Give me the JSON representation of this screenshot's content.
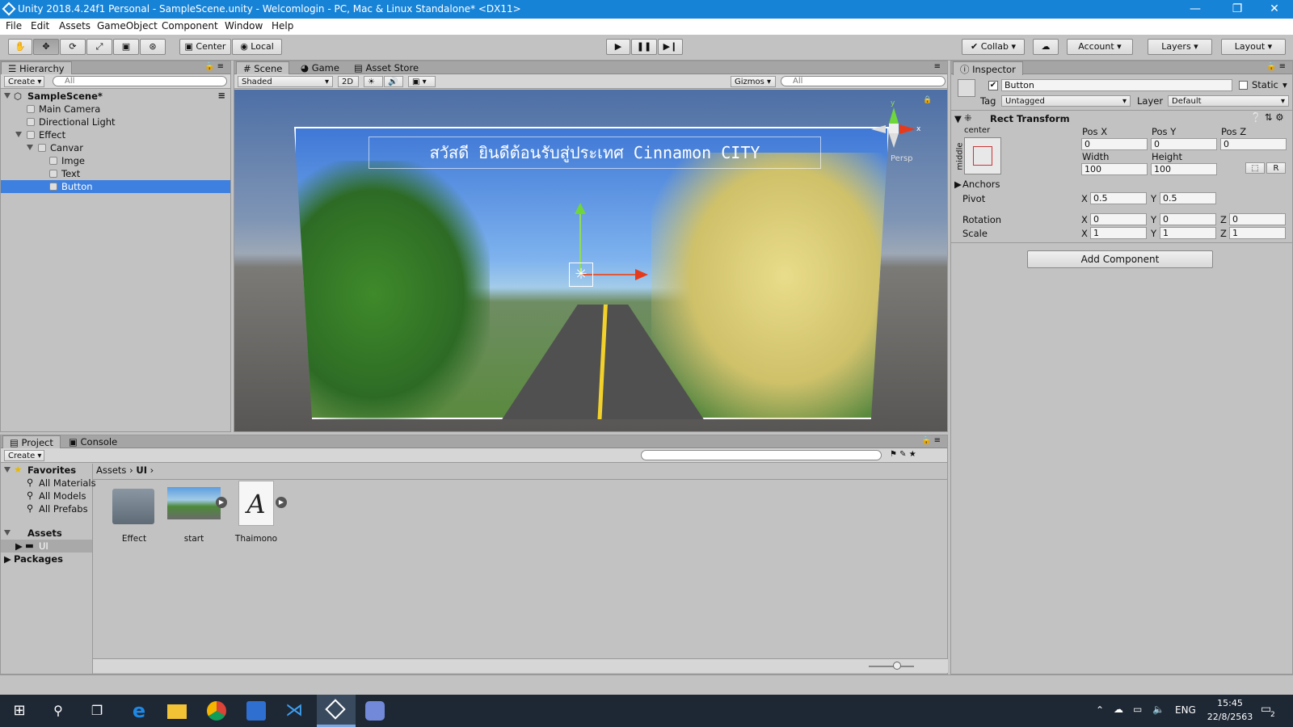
{
  "window": {
    "title": "Unity 2018.4.24f1 Personal - SampleScene.unity - Welcomlogin - PC, Mac & Linux Standalone* <DX11>",
    "controls": {
      "minimize": "—",
      "maximize": "❐",
      "close": "✕"
    }
  },
  "menu": [
    "File",
    "Edit",
    "Assets",
    "GameObject",
    "Component",
    "Window",
    "Help"
  ],
  "toolbar": {
    "pivot": "Center",
    "space": "Local",
    "collab": "Collab",
    "account": "Account",
    "layers": "Layers",
    "layout": "Layout"
  },
  "hierarchy": {
    "tab": "Hierarchy",
    "create": "Create",
    "search_placeholder": "All",
    "scene": "SampleScene*",
    "items": [
      "Main Camera",
      "Directional Light",
      "Effect",
      "Canvar",
      "Imge",
      "Text",
      "Button"
    ]
  },
  "scene_view": {
    "tabs": [
      "Scene",
      "Game",
      "Asset Store"
    ],
    "shading": "Shaded",
    "mode_2d": "2D",
    "gizmos": "Gizmos",
    "search_placeholder": "All",
    "banner_text": "สวัสดี ยินดีต้อนรับสู่ประเทศ Cinnamon CITY",
    "persp_label": "Persp",
    "axis_y": "y",
    "axis_x": "x"
  },
  "inspector": {
    "tab": "Inspector",
    "object_name": "Button",
    "static_label": "Static",
    "tag_label": "Tag",
    "tag_value": "Untagged",
    "layer_label": "Layer",
    "layer_value": "Default",
    "component": "Rect Transform",
    "anchor_h": "center",
    "anchor_v": "middle",
    "pos_x_label": "Pos X",
    "pos_x": "0",
    "pos_y_label": "Pos Y",
    "pos_y": "0",
    "pos_z_label": "Pos Z",
    "pos_z": "0",
    "width_label": "Width",
    "width": "100",
    "height_label": "Height",
    "height": "100",
    "r_button": "R",
    "anchors_label": "Anchors",
    "pivot_label": "Pivot",
    "pivot_x": "0.5",
    "pivot_y": "0.5",
    "rotation_label": "Rotation",
    "rot_x": "0",
    "rot_y": "0",
    "rot_z": "0",
    "scale_label": "Scale",
    "scale_x": "1",
    "scale_y": "1",
    "scale_z": "1",
    "axis_x": "X",
    "axis_y": "Y",
    "axis_z": "Z",
    "add_component": "Add Component"
  },
  "project": {
    "tabs": [
      "Project",
      "Console"
    ],
    "create": "Create",
    "favorites_label": "Favorites",
    "favorites": [
      "All Materials",
      "All Models",
      "All Prefabs"
    ],
    "assets_label": "Assets",
    "assets_children": [
      "UI"
    ],
    "packages_label": "Packages",
    "breadcrumb": [
      "Assets",
      "UI"
    ],
    "files": [
      "Effect",
      "start",
      "Thaimono"
    ]
  },
  "taskbar": {
    "time": "15:45",
    "date": "22/8/2563",
    "lang": "ENG",
    "notifications": "2"
  }
}
